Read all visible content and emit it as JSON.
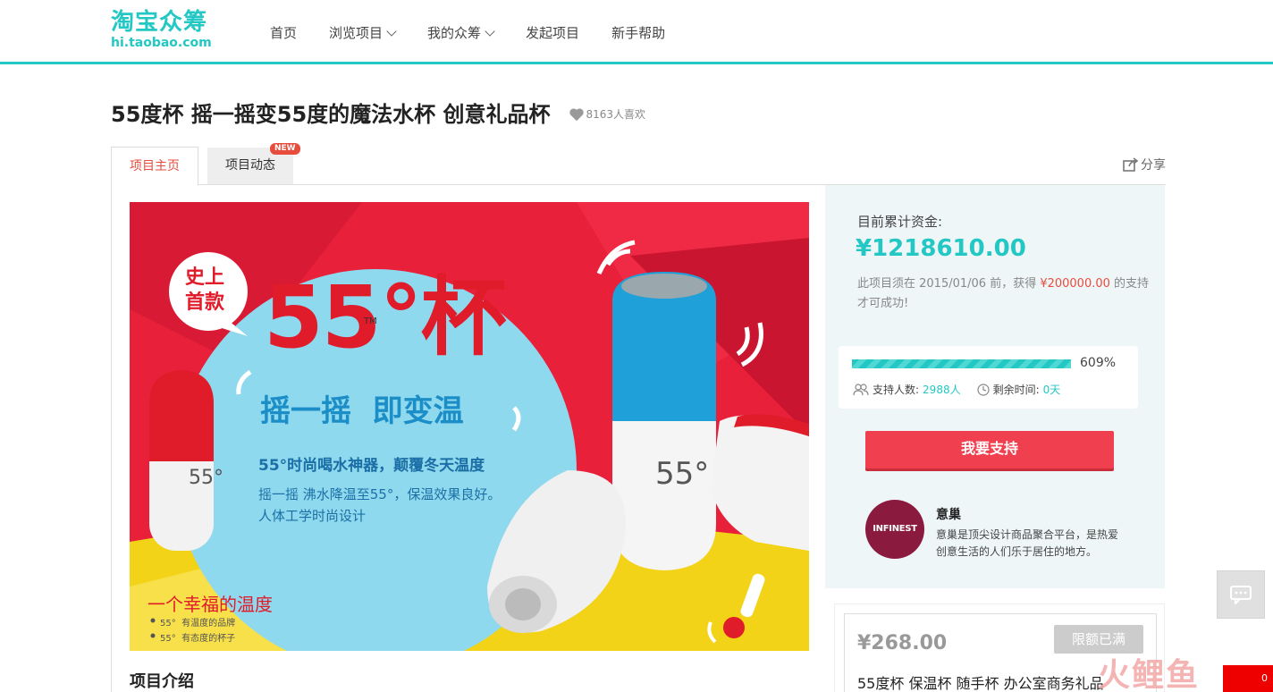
{
  "header": {
    "logo_cn": "淘宝众筹",
    "logo_en": "hi.taobao.com",
    "nav": [
      {
        "label": "首页",
        "has_dropdown": false
      },
      {
        "label": "浏览项目",
        "has_dropdown": true
      },
      {
        "label": "我的众筹",
        "has_dropdown": true
      },
      {
        "label": "发起项目",
        "has_dropdown": false
      },
      {
        "label": "新手帮助",
        "has_dropdown": false
      }
    ],
    "accent_color": "#23c8c4"
  },
  "project": {
    "title": "55度杯 摇一摇变55度的魔法水杯 创意礼品杯",
    "likes": "8163人喜欢"
  },
  "tabs": {
    "main": "项目主页",
    "news": "项目动态",
    "news_badge": "NEW",
    "share": "分享"
  },
  "banner": {
    "badge_line1": "史上",
    "badge_line2": "首款",
    "brand": "55°杯",
    "tm": "TM",
    "slogan": "摇一摇  即变温",
    "headline": "55°时尚喝水神器，颠覆冬天温度",
    "desc_line1": "摇一摇 沸水降温至55°，保温效果良好。",
    "desc_line2": "人体工学时尚设计",
    "bottom_title": "一个幸福的温度",
    "bullet1": "55°  有温度的品牌",
    "bullet2": "55°  有态度的杯子",
    "cup_mark": "55°"
  },
  "intro": {
    "title": "项目介绍"
  },
  "funding": {
    "label": "目前累计资金:",
    "amount": "¥1218610.00",
    "note_prefix": "此项目须在 2015/01/06 前，获得 ",
    "target": "¥200000.00",
    "note_suffix": " 的支持才可成功!",
    "progress_percent": 609,
    "progress_label": "609%",
    "supporters_label": "支持人数:",
    "supporters": "2988人",
    "remaining_label": "剩余时间:",
    "remaining": "0天",
    "support_button": "我要支持"
  },
  "sponsor": {
    "logo_text": "INFINEST",
    "name": "意巢",
    "desc": "意巢是顶尖设计商品聚合平台，是热爱创意生活的人们乐于居住的地方。"
  },
  "reward": {
    "price": "¥268.00",
    "status_button": "限额已满",
    "title": "55度杯 保温杯 随手杯 办公室商务礼品"
  },
  "watermark": "火鲤鱼",
  "corner_text": "0"
}
